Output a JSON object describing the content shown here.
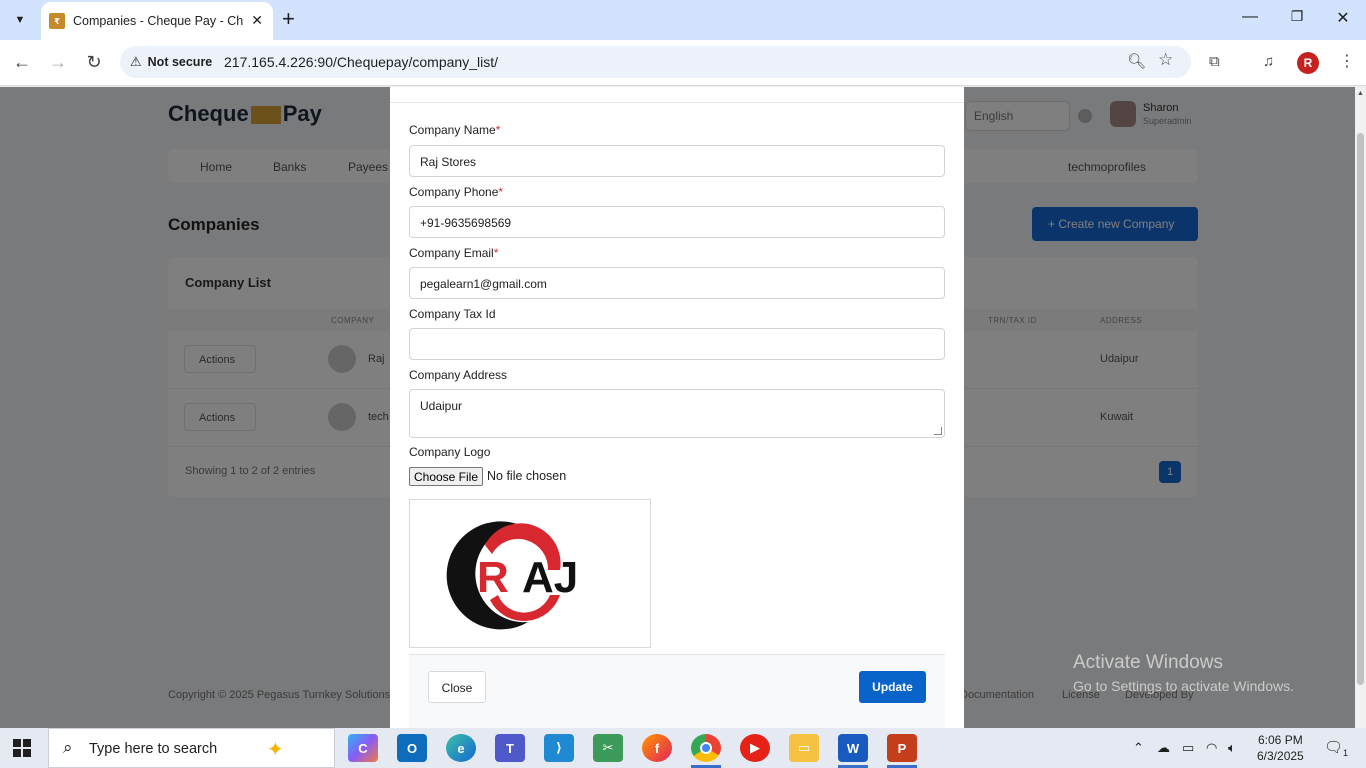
{
  "browser": {
    "tab_title": "Companies - Cheque Pay - Che",
    "security_label": "Not secure",
    "url": "217.165.4.226:90/Chequepay/company_list/",
    "profile_initial": "R"
  },
  "background_page": {
    "logo": {
      "left": "Cheque",
      "right": "Pay"
    },
    "language": "English",
    "user": {
      "name": "Sharon",
      "role": "Superadmin"
    },
    "nav_items": [
      "Home",
      "Banks",
      "Payees"
    ],
    "nav_user": "techmoprofiles",
    "page_title": "Companies",
    "create_button": "+ Create new Company",
    "card_title": "Company List",
    "table_headers": {
      "company": "COMPANY",
      "trn": "TRN/TAX ID",
      "address": "ADDRESS"
    },
    "rows": [
      {
        "action": "Actions",
        "name": "Raj",
        "address": "Udaipur"
      },
      {
        "action": "Actions",
        "name": "tech",
        "address": "Kuwait"
      }
    ],
    "showing": "Showing 1 to 2 of 2 entries",
    "page_number": "1",
    "footer_left": "Copyright © 2025 Pegasus Turnkey Solutions",
    "footer_links": [
      "Documentation",
      "License",
      "Developed By"
    ]
  },
  "modal": {
    "company_name": {
      "label": "Company Name",
      "value": "Raj Stores"
    },
    "company_phone": {
      "label": "Company Phone",
      "value": "+91-9635698569"
    },
    "company_email": {
      "label": "Company Email",
      "value": "pegalearn1@gmail.com"
    },
    "company_tax_id": {
      "label": "Company Tax Id",
      "value": ""
    },
    "company_address": {
      "label": "Company Address",
      "value": "Udaipur"
    },
    "company_logo": {
      "label": "Company Logo",
      "button": "Choose File",
      "status": "No file chosen",
      "logo_text": "RAJ"
    },
    "required_mark": "*",
    "close_button": "Close",
    "update_button": "Update"
  },
  "watermark": {
    "line1": "Activate Windows",
    "line2": "Go to Settings to activate Windows."
  },
  "taskbar": {
    "search_placeholder": "Type here to search",
    "time": "6:06 PM",
    "date": "6/3/2025",
    "notification_count": "1"
  },
  "colors": {
    "primary": "#0a63c9",
    "required": "#d32f2f",
    "logo_red": "#d8282f"
  }
}
